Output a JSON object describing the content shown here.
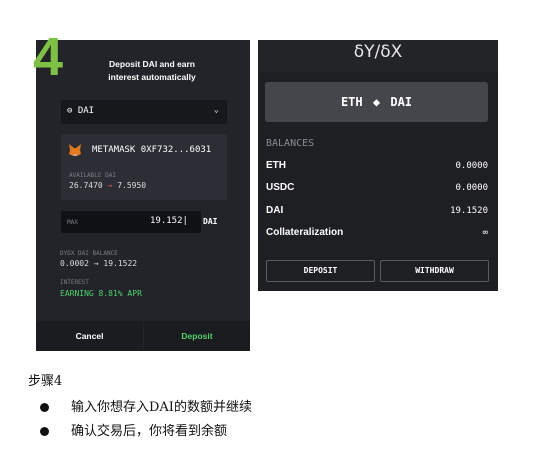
{
  "left_panel": {
    "step_number": "4",
    "title_line1": "Deposit DAI and earn",
    "title_line2": "interest automatically",
    "token": "DAI",
    "wallet_name": "METAMASK 0XF732...6031",
    "available_label": "AVAILABLE DAI",
    "available_from": "26.7470",
    "available_arrow": "→",
    "available_to": "7.5950",
    "max_label": "MAX",
    "amount": "19.152",
    "amount_unit": "DAI",
    "dydx_label": "DYDX DAI BALANCE",
    "dydx_from": "0.0002",
    "dydx_arrow": "→",
    "dydx_to": "19.1522",
    "interest_label": "INTEREST",
    "interest_value": "EARNING 8.81% APR",
    "cancel_label": "Cancel",
    "deposit_label": "Deposit",
    "accent_green": "#4cd36a",
    "step_green": "#7dc242"
  },
  "right_panel": {
    "logo": "δY/δX",
    "pair_base": "ETH",
    "pair_quote": "DAI",
    "balances_title": "BALANCES",
    "balances": [
      {
        "asset": "ETH",
        "value": "0.0000"
      },
      {
        "asset": "USDC",
        "value": "0.0000"
      },
      {
        "asset": "DAI",
        "value": "19.1520"
      },
      {
        "asset": "Collateralization",
        "value": "∞"
      }
    ],
    "deposit_label": "DEPOSIT",
    "withdraw_label": "WITHDRAW"
  },
  "caption": {
    "step": "步骤4",
    "bullets": [
      "输入你想存入DAI的数额并继续",
      "确认交易后，你将看到余额"
    ]
  }
}
